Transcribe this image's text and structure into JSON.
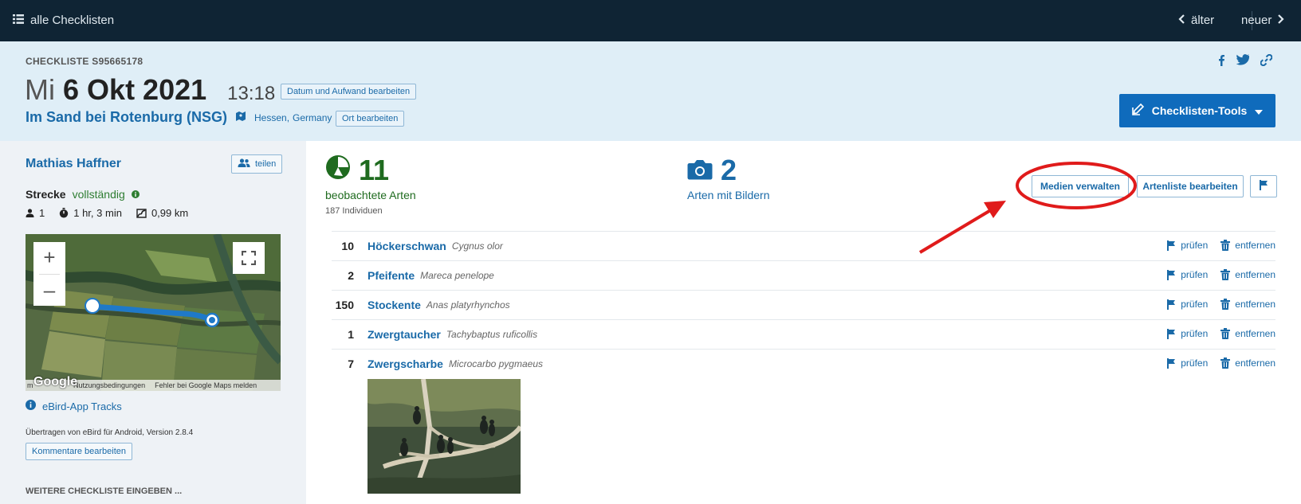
{
  "topbar": {
    "all_checklists": "alle Checklisten",
    "older": "älter",
    "newer": "neuer"
  },
  "header": {
    "checklist_id": "CHECKLISTE S95665178",
    "day_of_week": "Mi",
    "date": "6 Okt 2021",
    "time": "13:18",
    "edit_date_button": "Datum und Aufwand bearbeiten",
    "location_name": "Im Sand bei Rotenburg (NSG)",
    "region": "Hessen,",
    "country": "Germany",
    "edit_location_button": "Ort bearbeiten",
    "tools_button": "Checklisten-Tools"
  },
  "sidebar": {
    "observer": "Mathias Haffner",
    "share_button": "teilen",
    "route_label": "Strecke",
    "route_status": "vollständig",
    "party_size": "1",
    "duration": "1 hr, 3 min",
    "distance": "0,99 km",
    "map": {
      "google": "Google",
      "terms": "Nutzungsbedingungen",
      "report": "Fehler bei Google Maps melden",
      "scale_mark": "m"
    },
    "tracks_link": "eBird-App Tracks",
    "submitted": "Übertragen von eBird für Android, Version 2.8.4",
    "comments_button": "Kommentare bearbeiten",
    "more_heading": "WEITERE CHECKLISTE EINGEBEN ..."
  },
  "main": {
    "species_count": "11",
    "species_label": "beobachtete Arten",
    "individuals": "187 Individuen",
    "photo_count": "2",
    "photo_label": "Arten mit Bildern",
    "manage_media_button": "Medien verwalten",
    "edit_species_button": "Artenliste bearbeiten",
    "review_label": "prüfen",
    "remove_label": "entfernen",
    "species": [
      {
        "count": "10",
        "name": "Höckerschwan",
        "sci": "Cygnus olor"
      },
      {
        "count": "2",
        "name": "Pfeifente",
        "sci": "Mareca penelope"
      },
      {
        "count": "150",
        "name": "Stockente",
        "sci": "Anas platyrhynchos"
      },
      {
        "count": "1",
        "name": "Zwergtaucher",
        "sci": "Tachybaptus ruficollis"
      },
      {
        "count": "7",
        "name": "Zwergscharbe",
        "sci": "Microcarbo pygmaeus"
      }
    ]
  },
  "colors": {
    "topbar_bg": "#0f2434",
    "header_bg": "#dfeef7",
    "sidebar_bg": "#eef2f6",
    "link_blue": "#1a6aa8",
    "primary_blue": "#0f6bbc",
    "species_green": "#1f6b1f",
    "annotation_red": "#e01b1b"
  },
  "icons": {
    "list": "list-icon",
    "chevron_left": "chevron-left-icon",
    "chevron_right": "chevron-right-icon",
    "facebook": "facebook-icon",
    "twitter": "twitter-icon",
    "link": "link-icon",
    "edit": "edit-icon",
    "caret": "caret-down-icon",
    "map_pin": "map-icon",
    "people": "people-icon",
    "person": "person-icon",
    "stopwatch": "stopwatch-icon",
    "route": "route-icon",
    "info": "info-icon",
    "species_pie": "species-pie-icon",
    "camera": "camera-icon",
    "flag": "flag-icon",
    "trash": "trash-icon"
  }
}
